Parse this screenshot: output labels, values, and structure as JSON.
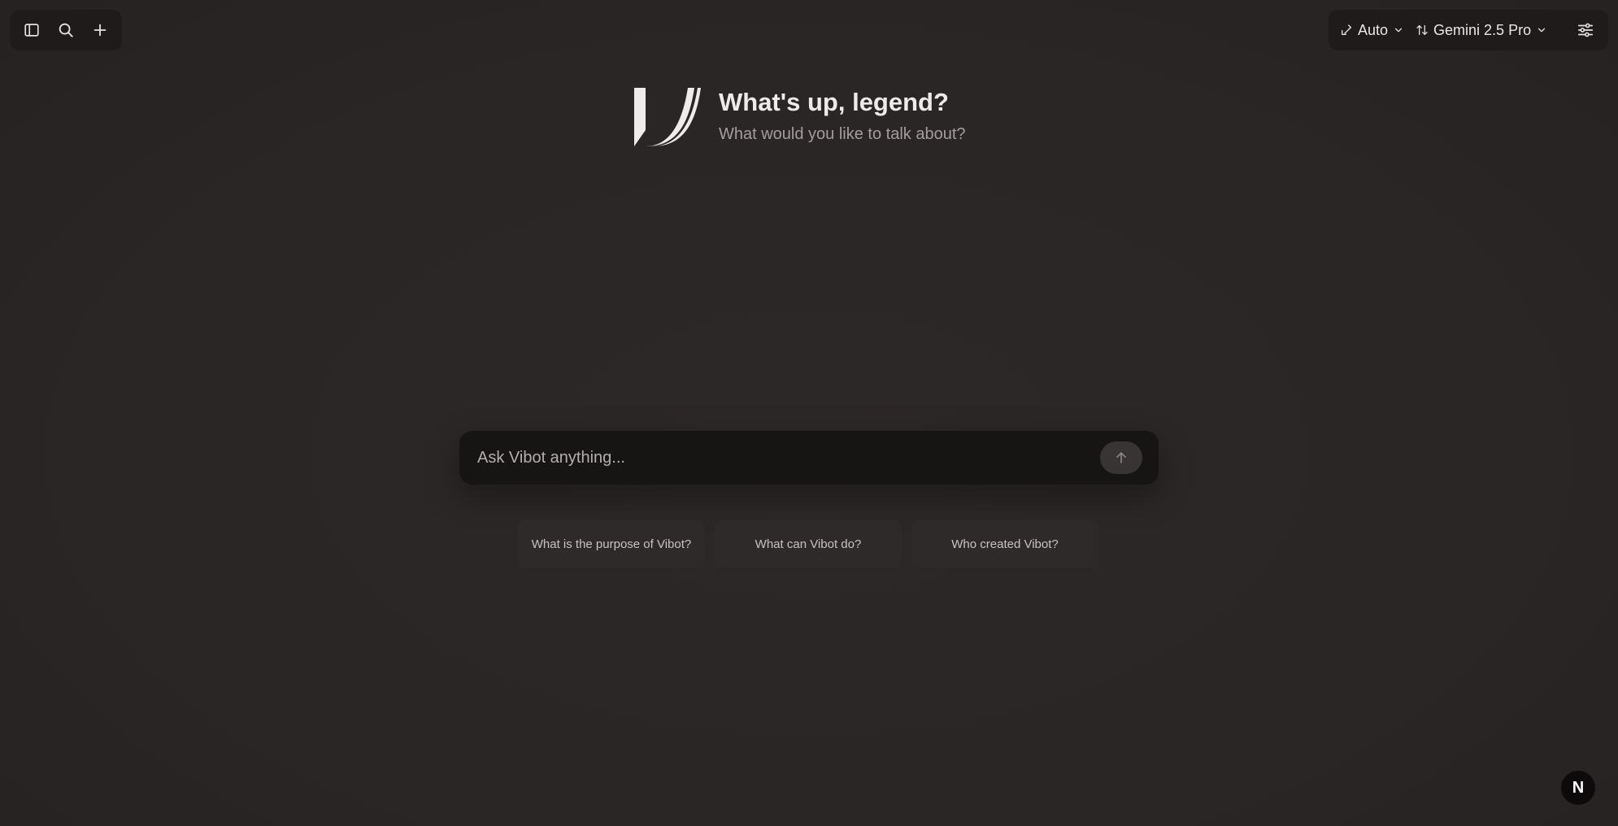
{
  "toolbar_left": {
    "icons": [
      "sidebar-toggle-icon",
      "search-icon",
      "plus-icon"
    ]
  },
  "toolbar_right": {
    "mode_label": "Auto",
    "model_label": "Gemini 2.5 Pro",
    "icons": [
      "swap-icon",
      "sort-icon",
      "chevron-down-icon",
      "sliders-icon"
    ]
  },
  "hero": {
    "title": "What's up, legend?",
    "subtitle": "What would you like to talk about?"
  },
  "chat": {
    "placeholder": "Ask Vibot anything..."
  },
  "suggestions": [
    "What is the purpose of Vibot?",
    "What can Vibot do?",
    "Who created Vibot?"
  ],
  "badge": {
    "letter": "N"
  },
  "colors": {
    "background": "#2b2727",
    "toolbar": "#1f1b1b",
    "input": "#171414",
    "chip": "#2f2a2a",
    "text_primary": "#eeeaea",
    "text_secondary": "#a49d9d"
  }
}
